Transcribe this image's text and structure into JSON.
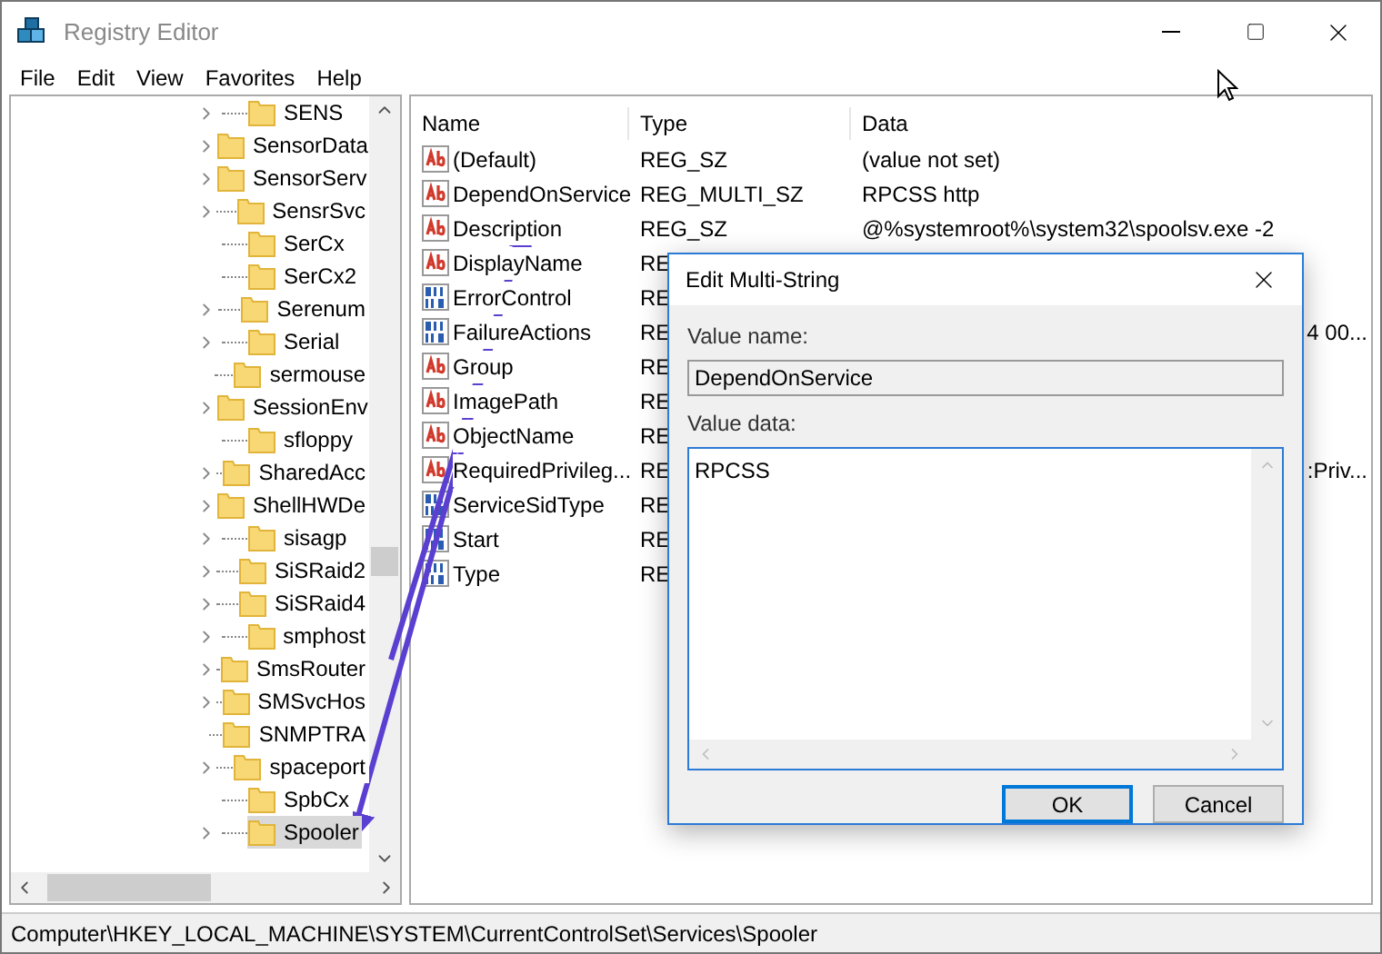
{
  "window": {
    "title": "Registry Editor"
  },
  "menu": [
    "File",
    "Edit",
    "View",
    "Favorites",
    "Help"
  ],
  "tree": {
    "items": [
      {
        "label": "SENS",
        "expandable": true,
        "selected": false
      },
      {
        "label": "SensorData",
        "expandable": true,
        "selected": false
      },
      {
        "label": "SensorServ",
        "expandable": true,
        "selected": false
      },
      {
        "label": "SensrSvc",
        "expandable": true,
        "selected": false
      },
      {
        "label": "SerCx",
        "expandable": false,
        "selected": false
      },
      {
        "label": "SerCx2",
        "expandable": false,
        "selected": false
      },
      {
        "label": "Serenum",
        "expandable": true,
        "selected": false
      },
      {
        "label": "Serial",
        "expandable": true,
        "selected": false
      },
      {
        "label": "sermouse",
        "expandable": false,
        "selected": false
      },
      {
        "label": "SessionEnv",
        "expandable": true,
        "selected": false
      },
      {
        "label": "sfloppy",
        "expandable": false,
        "selected": false
      },
      {
        "label": "SharedAcc",
        "expandable": true,
        "selected": false
      },
      {
        "label": "ShellHWDe",
        "expandable": true,
        "selected": false
      },
      {
        "label": "sisagp",
        "expandable": true,
        "selected": false
      },
      {
        "label": "SiSRaid2",
        "expandable": true,
        "selected": false
      },
      {
        "label": "SiSRaid4",
        "expandable": true,
        "selected": false
      },
      {
        "label": "smphost",
        "expandable": true,
        "selected": false
      },
      {
        "label": "SmsRouter",
        "expandable": true,
        "selected": false
      },
      {
        "label": "SMSvcHos",
        "expandable": true,
        "selected": false
      },
      {
        "label": "SNMPTRA",
        "expandable": false,
        "selected": false
      },
      {
        "label": "spaceport",
        "expandable": true,
        "selected": false
      },
      {
        "label": "SpbCx",
        "expandable": false,
        "selected": false
      },
      {
        "label": "Spooler",
        "expandable": true,
        "selected": true
      }
    ]
  },
  "values": {
    "columns": [
      "Name",
      "Type",
      "Data"
    ],
    "rows": [
      {
        "kind": "string",
        "name": "(Default)",
        "type": "REG_SZ",
        "data": "(value not set)"
      },
      {
        "kind": "string",
        "name": "DependOnService",
        "type": "REG_MULTI_SZ",
        "data": "RPCSS http"
      },
      {
        "kind": "string",
        "name": "Description",
        "type": "REG_SZ",
        "data": "@%systemroot%\\system32\\spoolsv.exe -2"
      },
      {
        "kind": "string",
        "name": "DisplayName",
        "type": "RE"
      },
      {
        "kind": "binary",
        "name": "ErrorControl",
        "type": "RE"
      },
      {
        "kind": "binary",
        "name": "FailureActions",
        "type": "RE",
        "data_end": "4 00..."
      },
      {
        "kind": "string",
        "name": "Group",
        "type": "RE"
      },
      {
        "kind": "string",
        "name": "ImagePath",
        "type": "RE"
      },
      {
        "kind": "string",
        "name": "ObjectName",
        "type": "RE"
      },
      {
        "kind": "string",
        "name": "RequiredPrivileg...",
        "type": "RE",
        "data_end": ":Priv..."
      },
      {
        "kind": "binary",
        "name": "ServiceSidType",
        "type": "RE"
      },
      {
        "kind": "binary",
        "name": "Start",
        "type": "RE"
      },
      {
        "kind": "binary",
        "name": "Type",
        "type": "RE"
      }
    ]
  },
  "status_bar": "Computer\\HKEY_LOCAL_MACHINE\\SYSTEM\\CurrentControlSet\\Services\\Spooler",
  "dialog": {
    "title": "Edit Multi-String",
    "value_name_label": "Value name:",
    "value_name": "DependOnService",
    "value_data_label": "Value data:",
    "value_data": "RPCSS",
    "buttons": [
      {
        "label": "OK",
        "default": true
      },
      {
        "label": "Cancel",
        "default": false
      }
    ]
  }
}
